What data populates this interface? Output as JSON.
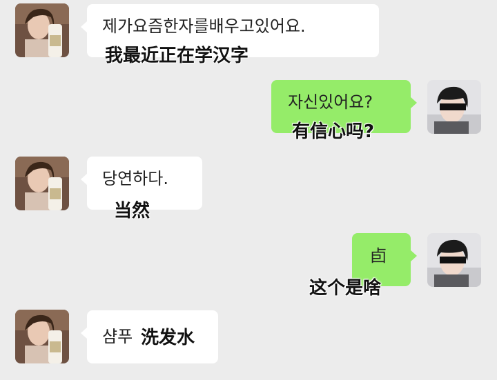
{
  "messages": [
    {
      "side": "left",
      "text": "제가요즘한자를배우고있어요.",
      "caption": "我最近正在学汉字"
    },
    {
      "side": "right",
      "text": "자신있어요?",
      "caption": "有信心吗?"
    },
    {
      "side": "left",
      "text": "당연하다.",
      "caption": "当然"
    },
    {
      "side": "right",
      "text": "卣",
      "caption": "这个是啥"
    },
    {
      "side": "left",
      "text": "샴푸",
      "caption": "洗发水"
    }
  ],
  "colors": {
    "background": "#ececec",
    "sent_bubble": "#95ec69",
    "received_bubble": "#ffffff"
  }
}
